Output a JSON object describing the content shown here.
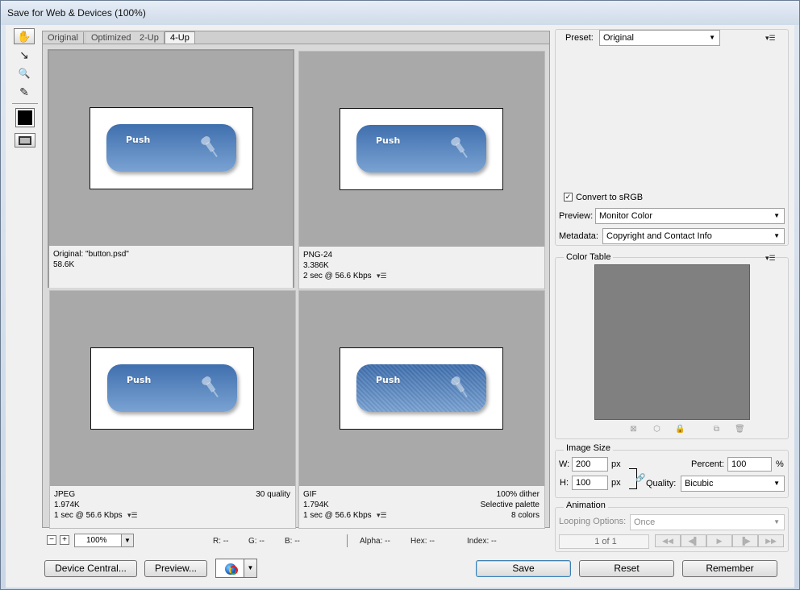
{
  "window": {
    "title": "Save for Web & Devices (100%)"
  },
  "tools": [
    {
      "name": "hand-tool",
      "glyph": "✋"
    },
    {
      "name": "slice-select-tool",
      "glyph": "↘"
    },
    {
      "name": "zoom-tool",
      "glyph": "🔍"
    },
    {
      "name": "eyedropper-tool",
      "glyph": "✎"
    }
  ],
  "eyedropper_color": "#000000",
  "tabs": [
    "Original",
    "Optimized",
    "2-Up",
    "4-Up"
  ],
  "active_tab": "4-Up",
  "button_text": "Push",
  "panes": [
    {
      "line1": "Original: \"button.psd\"",
      "line2": "58.6K",
      "line3": "",
      "right1": "",
      "right2": "",
      "right3": ""
    },
    {
      "line1": "PNG-24",
      "line2": "3.386K",
      "line3": "2 sec @ 56.6 Kbps",
      "right1": "",
      "right2": "",
      "right3": ""
    },
    {
      "line1": "JPEG",
      "line2": "1.974K",
      "line3": "1 sec @ 56.6 Kbps",
      "right1": "30 quality",
      "right2": "",
      "right3": ""
    },
    {
      "line1": "GIF",
      "line2": "1.794K",
      "line3": "1 sec @ 56.6 Kbps",
      "right1": "100% dither",
      "right2": "Selective palette",
      "right3": "8 colors"
    }
  ],
  "status": {
    "zoom_minus": "−",
    "zoom_plus": "+",
    "zoom": "100%",
    "r": "R: --",
    "g": "G: --",
    "b": "B: --",
    "alpha": "Alpha: --",
    "hex": "Hex: --",
    "index": "Index: --"
  },
  "buttons": {
    "device_central": "Device Central...",
    "preview": "Preview...",
    "save": "Save",
    "reset": "Reset",
    "remember": "Remember"
  },
  "settings": {
    "preset_label": "Preset:",
    "preset_value": "Original",
    "convert_srgb_label": "Convert to sRGB",
    "convert_srgb_checked": true,
    "preview_label": "Preview:",
    "preview_value": "Monitor Color",
    "metadata_label": "Metadata:",
    "metadata_value": "Copyright and Contact Info"
  },
  "color_table": {
    "title": "Color Table",
    "fill": "#808080"
  },
  "image_size": {
    "title": "Image Size",
    "w_label": "W:",
    "w_value": "200",
    "w_unit": "px",
    "h_label": "H:",
    "h_value": "100",
    "h_unit": "px",
    "percent_label": "Percent:",
    "percent_value": "100",
    "percent_unit": "%",
    "quality_label": "Quality:",
    "quality_value": "Bicubic"
  },
  "animation": {
    "title": "Animation",
    "looping_label": "Looping Options:",
    "looping_value": "Once",
    "frame_counter": "1 of 1"
  }
}
